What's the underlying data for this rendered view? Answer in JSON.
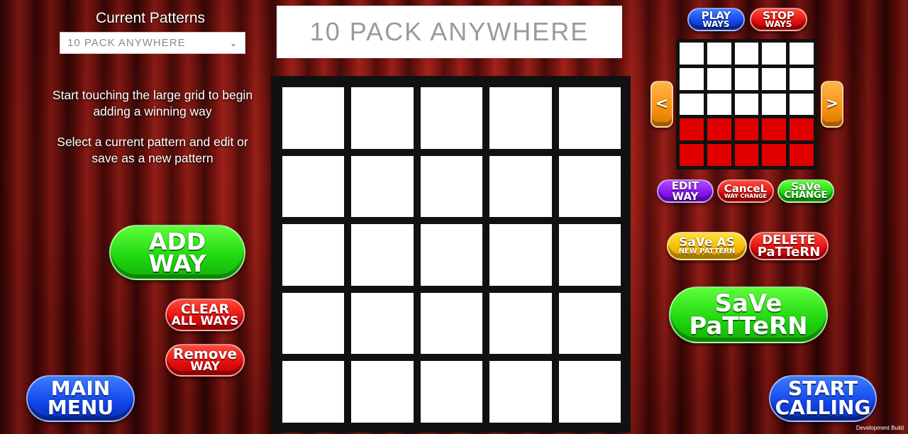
{
  "left_panel": {
    "patterns_label": "Current Patterns",
    "selected_pattern": "10 PACK ANYWHERE",
    "instruction_1": "Start touching the large grid to begin adding a winning way",
    "instruction_2": "Select a current pattern and edit or save as a new pattern"
  },
  "title": "10 PACK ANYWHERE",
  "buttons": {
    "add_way": [
      "ADD",
      "WAY"
    ],
    "clear_all_ways": [
      "CLEAR",
      "ALL WAYS"
    ],
    "remove_way": [
      "Remove",
      "WAY"
    ],
    "main_menu": [
      "MAIN",
      "MENU"
    ],
    "play_ways": [
      "PLAY",
      "WAYS"
    ],
    "stop_ways": [
      "STOP",
      "WAYS"
    ],
    "edit_way": [
      "EDIT",
      "WAY"
    ],
    "cancel_way_change": [
      "CanceL",
      "WAY CHANGE"
    ],
    "save_change": [
      "SaVe",
      "CHANGE"
    ],
    "save_as_new_pattern": [
      "SaVe AS",
      "NEW PATTERN"
    ],
    "delete_pattern": [
      "DELETE",
      "PaTTeRN"
    ],
    "save_pattern": [
      "SaVe",
      "PaTTeRN"
    ],
    "start_calling": [
      "START",
      "CALLING"
    ],
    "prev_arrow": "<",
    "next_arrow": ">"
  },
  "mini_grid": {
    "rows": [
      [
        0,
        0,
        0,
        0,
        0
      ],
      [
        0,
        0,
        0,
        0,
        0
      ],
      [
        0,
        0,
        0,
        0,
        0
      ],
      [
        1,
        1,
        1,
        1,
        1
      ],
      [
        1,
        1,
        1,
        1,
        1
      ]
    ]
  },
  "footer": "Development Build",
  "colors": {
    "highlight": "#e00000",
    "grid_bg": "#111111"
  }
}
